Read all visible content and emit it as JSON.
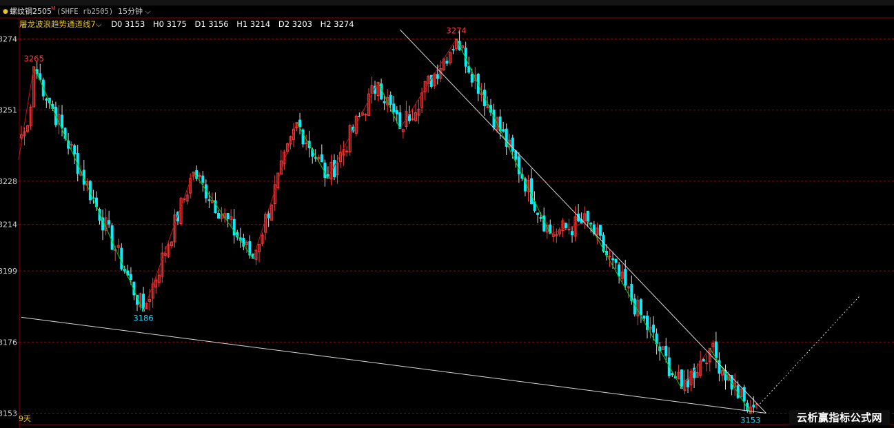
{
  "header": {
    "dot": "●",
    "symbol": "螺纹钢2505",
    "symbol_marker": "M",
    "exchange": "(SHFE rb2505)",
    "period": "15分钟",
    "period_chevron": "⌵"
  },
  "indicator": {
    "name": "屠龙波浪趋势通道线7",
    "chevron": "⌵",
    "values": [
      {
        "label": "D0",
        "value": "3153"
      },
      {
        "label": "H0",
        "value": "3175"
      },
      {
        "label": "D1",
        "value": "3156"
      },
      {
        "label": "H1",
        "value": "3214"
      },
      {
        "label": "D2",
        "value": "3203"
      },
      {
        "label": "H2",
        "value": "3274"
      }
    ]
  },
  "footer": {
    "label": "9天"
  },
  "watermark": {
    "text": "云析赢指标公式网"
  },
  "colors": {
    "up": "#ff3b3b",
    "down": "#00f0ff",
    "dashed_grid": "#7a1010",
    "axis": "#8b0000",
    "wave_up": "#d01010",
    "wave_down": "#00d000",
    "channel": "#d8d8d8",
    "peak_label": "#ff3b3b",
    "trough_label": "#20d8ff"
  },
  "chart_data": {
    "type": "candlestick",
    "y_ticks": [
      3274,
      3251,
      3228,
      3214,
      3199,
      3176,
      3153
    ],
    "ylim": [
      3152,
      3277
    ],
    "grid": true,
    "pivots": [
      {
        "type": "peak",
        "bar": 4,
        "value": 3265
      },
      {
        "type": "trough",
        "bar": 39,
        "value": 3186
      },
      {
        "type": "peak",
        "bar": 55,
        "value": 3231
      },
      {
        "type": "trough",
        "bar": 74,
        "value": 3203
      },
      {
        "type": "peak",
        "bar": 88,
        "value": 3247
      },
      {
        "type": "trough",
        "bar": 98,
        "value": 3229
      },
      {
        "type": "peak",
        "bar": 114,
        "value": 3260
      },
      {
        "type": "trough",
        "bar": 121,
        "value": 3245
      },
      {
        "type": "peak",
        "bar": 139,
        "value": 3274
      },
      {
        "type": "trough",
        "bar": 169,
        "value": 3211
      },
      {
        "type": "peak",
        "bar": 181,
        "value": 3215
      },
      {
        "type": "trough",
        "bar": 211,
        "value": 3161
      },
      {
        "type": "peak",
        "bar": 220,
        "value": 3174
      },
      {
        "type": "trough",
        "bar": 233,
        "value": 3153
      }
    ],
    "labels": [
      {
        "text": "3265",
        "bar": 4,
        "value": 3265,
        "kind": "peak"
      },
      {
        "text": "3186",
        "bar": 39,
        "value": 3186,
        "kind": "trough"
      },
      {
        "text": "3274",
        "bar": 139,
        "value": 3274,
        "kind": "peak"
      },
      {
        "text": "3153",
        "bar": 233,
        "value": 3153,
        "kind": "trough"
      }
    ],
    "channel_lines": [
      {
        "from": {
          "bar": 121,
          "value": 3277
        },
        "to": {
          "bar": 238,
          "value": 3153
        },
        "style": "solid"
      },
      {
        "from": {
          "bar": 0,
          "value": 3184
        },
        "to": {
          "bar": 238,
          "value": 3153
        },
        "style": "solid"
      },
      {
        "from": {
          "bar": 236,
          "value": 3156
        },
        "to": {
          "bar": 268,
          "value": 3191
        },
        "style": "dotted"
      }
    ]
  }
}
